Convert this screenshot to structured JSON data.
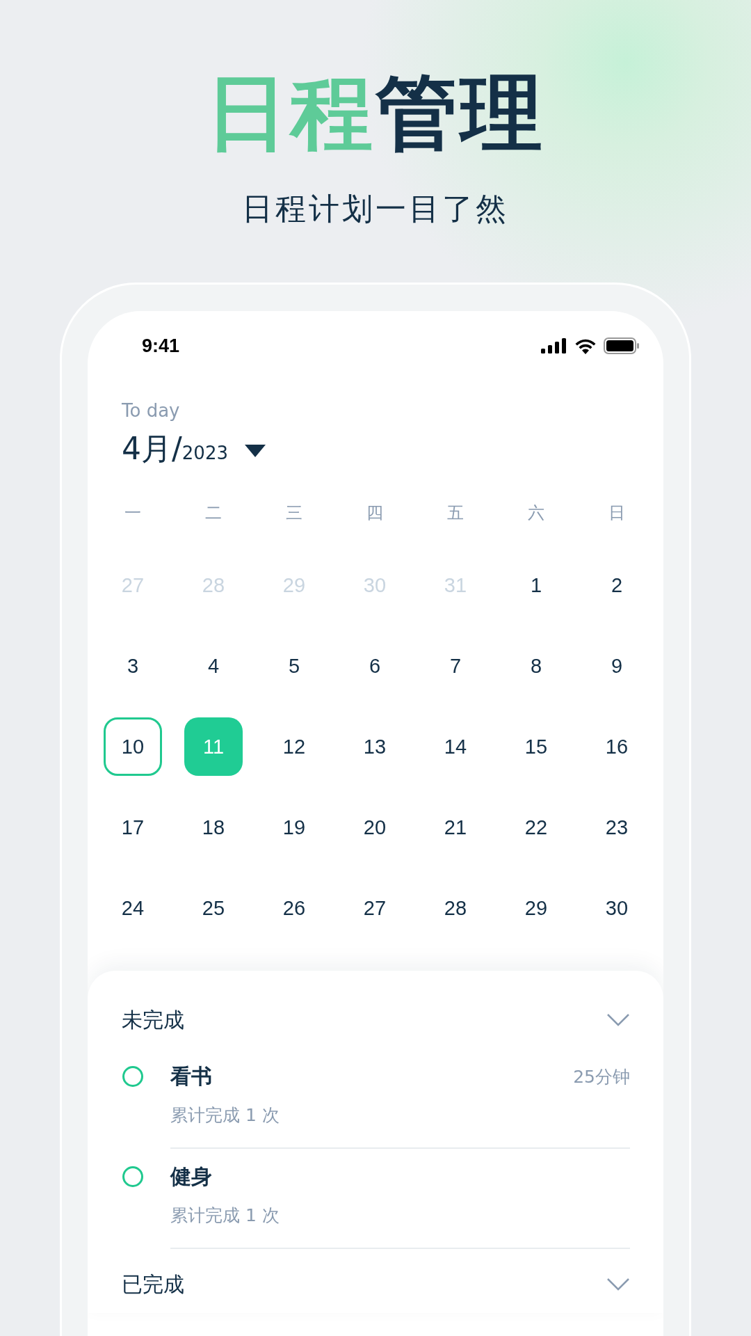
{
  "headline": {
    "parts": [
      {
        "text": "日程",
        "accent": true
      },
      {
        "text": "管理",
        "accent": false
      }
    ]
  },
  "subtitle": "日程计划一目了然",
  "phone": {
    "status_bar": {
      "time": "9:41"
    },
    "header": {
      "label": "To day",
      "month": "4月/",
      "year": "2023"
    },
    "weekdays": [
      "一",
      "二",
      "三",
      "四",
      "五",
      "六",
      "日"
    ],
    "days": [
      {
        "text": "27",
        "in_month": false,
        "today": false,
        "selected": false
      },
      {
        "text": "28",
        "in_month": false,
        "today": false,
        "selected": false
      },
      {
        "text": "29",
        "in_month": false,
        "today": false,
        "selected": false
      },
      {
        "text": "30",
        "in_month": false,
        "today": false,
        "selected": false
      },
      {
        "text": "31",
        "in_month": false,
        "today": false,
        "selected": false
      },
      {
        "text": "1",
        "in_month": true,
        "today": false,
        "selected": false
      },
      {
        "text": "2",
        "in_month": true,
        "today": false,
        "selected": false
      },
      {
        "text": "3",
        "in_month": true,
        "today": false,
        "selected": false
      },
      {
        "text": "4",
        "in_month": true,
        "today": false,
        "selected": false
      },
      {
        "text": "5",
        "in_month": true,
        "today": false,
        "selected": false
      },
      {
        "text": "6",
        "in_month": true,
        "today": false,
        "selected": false
      },
      {
        "text": "7",
        "in_month": true,
        "today": false,
        "selected": false
      },
      {
        "text": "8",
        "in_month": true,
        "today": false,
        "selected": false
      },
      {
        "text": "9",
        "in_month": true,
        "today": false,
        "selected": false
      },
      {
        "text": "10",
        "in_month": true,
        "today": true,
        "selected": false
      },
      {
        "text": "11",
        "in_month": true,
        "today": false,
        "selected": true
      },
      {
        "text": "12",
        "in_month": true,
        "today": false,
        "selected": false
      },
      {
        "text": "13",
        "in_month": true,
        "today": false,
        "selected": false
      },
      {
        "text": "14",
        "in_month": true,
        "today": false,
        "selected": false
      },
      {
        "text": "15",
        "in_month": true,
        "today": false,
        "selected": false
      },
      {
        "text": "16",
        "in_month": true,
        "today": false,
        "selected": false
      },
      {
        "text": "17",
        "in_month": true,
        "today": false,
        "selected": false
      },
      {
        "text": "18",
        "in_month": true,
        "today": false,
        "selected": false
      },
      {
        "text": "19",
        "in_month": true,
        "today": false,
        "selected": false
      },
      {
        "text": "20",
        "in_month": true,
        "today": false,
        "selected": false
      },
      {
        "text": "21",
        "in_month": true,
        "today": false,
        "selected": false
      },
      {
        "text": "22",
        "in_month": true,
        "today": false,
        "selected": false
      },
      {
        "text": "23",
        "in_month": true,
        "today": false,
        "selected": false
      },
      {
        "text": "24",
        "in_month": true,
        "today": false,
        "selected": false
      },
      {
        "text": "25",
        "in_month": true,
        "today": false,
        "selected": false
      },
      {
        "text": "26",
        "in_month": true,
        "today": false,
        "selected": false
      },
      {
        "text": "27",
        "in_month": true,
        "today": false,
        "selected": false
      },
      {
        "text": "28",
        "in_month": true,
        "today": false,
        "selected": false
      },
      {
        "text": "29",
        "in_month": true,
        "today": false,
        "selected": false
      },
      {
        "text": "30",
        "in_month": true,
        "today": false,
        "selected": false
      }
    ],
    "sections": [
      {
        "title": "未完成",
        "tasks": [
          {
            "name": "看书",
            "duration": "25分钟",
            "count": "累计完成 1 次",
            "done": false
          },
          {
            "name": "健身",
            "count": "累计完成 1 次",
            "done": false
          }
        ]
      },
      {
        "title": "已完成"
      }
    ]
  }
}
